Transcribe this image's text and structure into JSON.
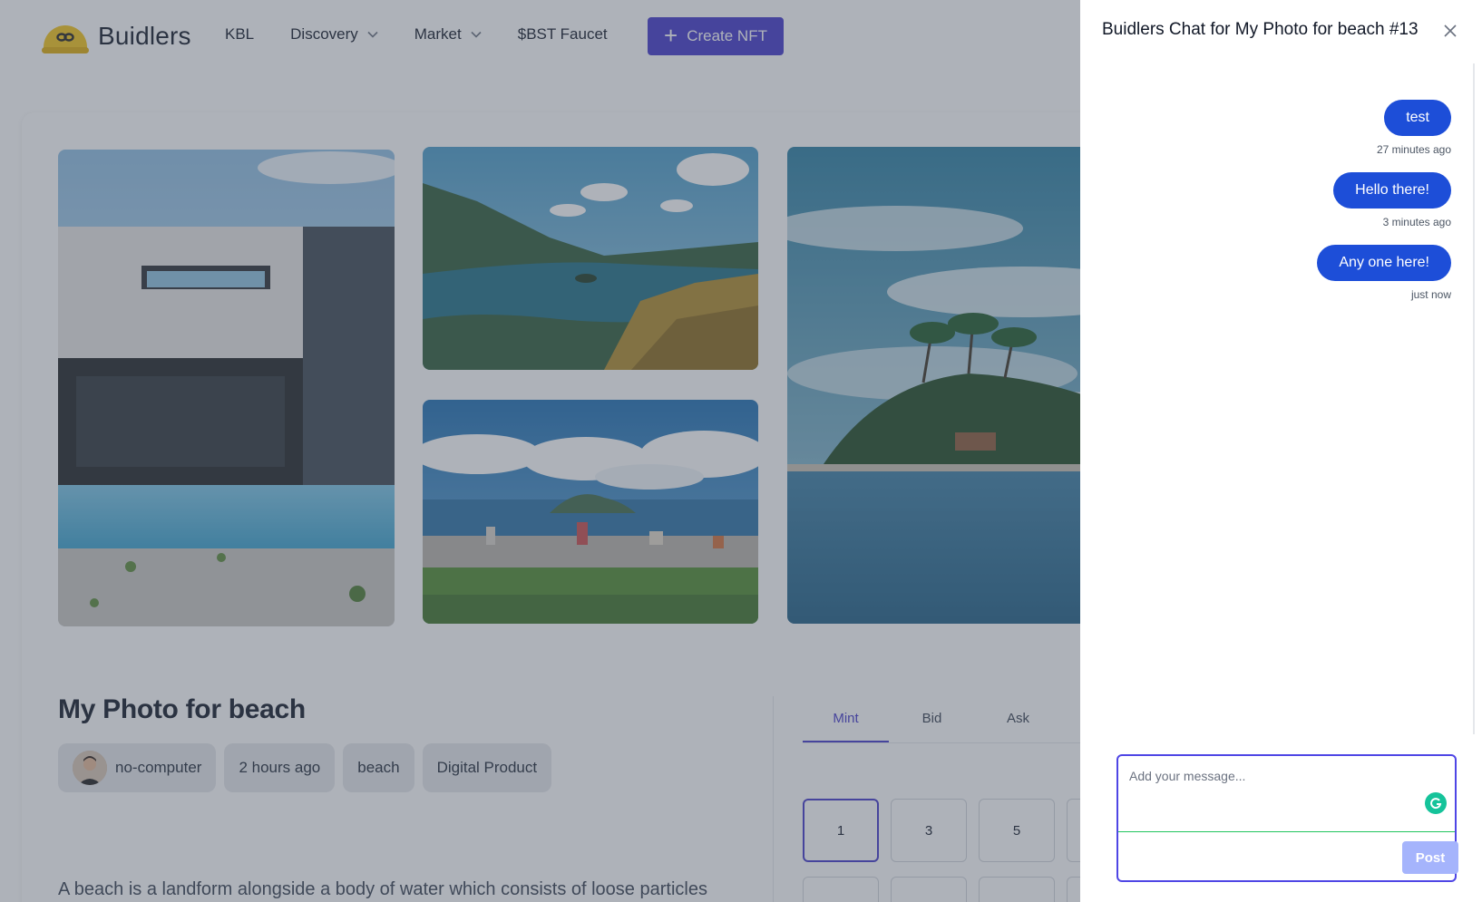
{
  "header": {
    "brand": "Buidlers",
    "nav": {
      "kbl": "KBL",
      "discovery": "Discovery",
      "market": "Market",
      "faucet": "$BST Faucet"
    },
    "create_label": "Create NFT"
  },
  "nft": {
    "title": "My Photo for beach",
    "creator": "no-computer",
    "time": "2 hours ago",
    "tag": "beach",
    "category": "Digital Product",
    "description": "A beach is a landform alongside a body of water which consists of loose particles"
  },
  "trade": {
    "tabs": [
      "Mint",
      "Bid",
      "Ask"
    ],
    "active_tab": "Mint",
    "quantities": [
      "1",
      "3",
      "5"
    ],
    "selected_quantity": "1"
  },
  "chat": {
    "title": "Buidlers Chat for My Photo for beach #13",
    "messages": [
      {
        "text": "test",
        "time": "27 minutes ago"
      },
      {
        "text": "Hello there!",
        "time": "3 minutes ago"
      },
      {
        "text": "Any one here!",
        "time": "just now"
      }
    ],
    "placeholder": "Add your message...",
    "post_label": "Post"
  },
  "colors": {
    "primary": "#4338ca",
    "bubble": "#1d4ed8",
    "post_disabled": "#a5b4fc",
    "overlay": "rgba(75, 85, 99, 0.45)"
  }
}
